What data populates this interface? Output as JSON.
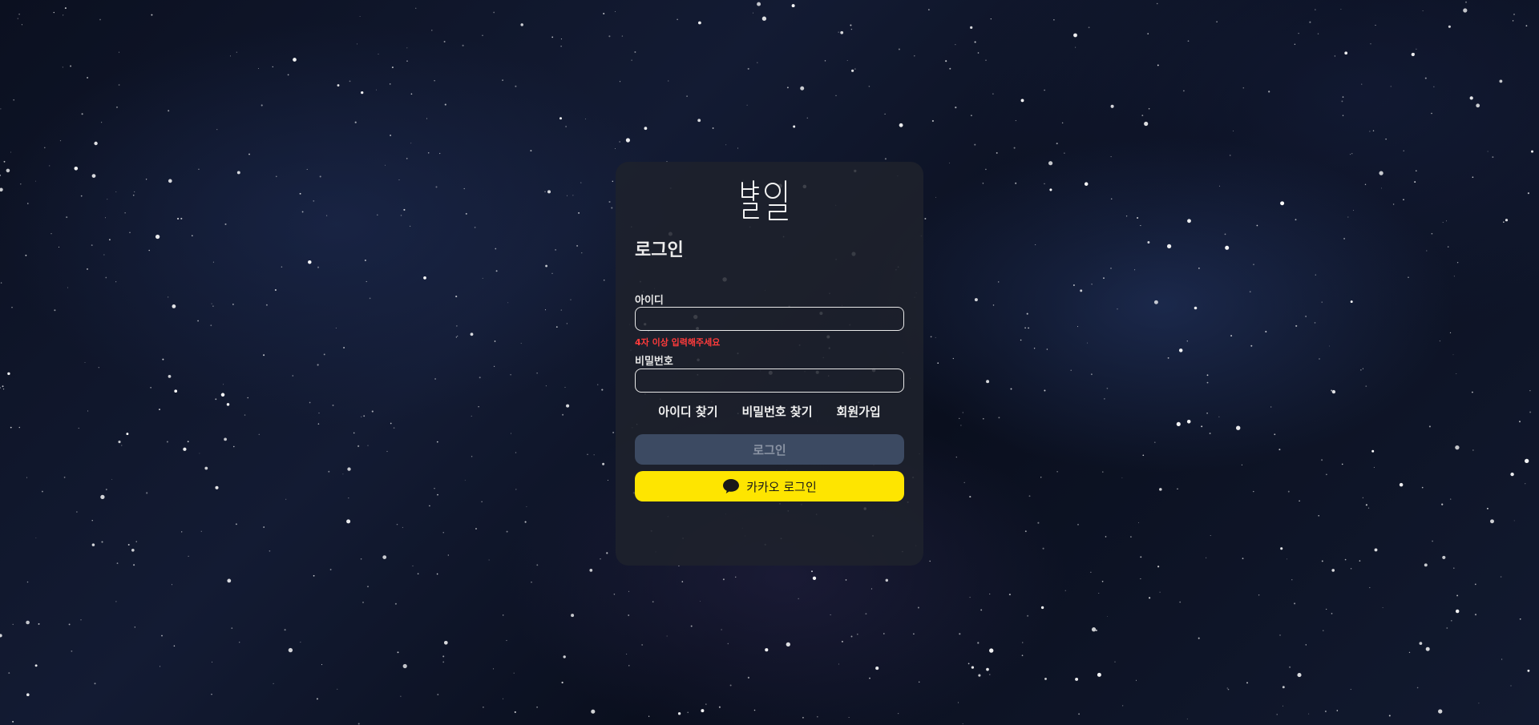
{
  "brand": {
    "logo_text": "별일"
  },
  "login_form": {
    "title": "로그인",
    "id_label": "아이디",
    "id_value": "",
    "id_error": "4자 이상 입력해주세요",
    "password_label": "비밀번호",
    "password_value": ""
  },
  "links": {
    "find_id": "아이디 찾기",
    "find_password": "비밀번호 찾기",
    "signup": "회원가입"
  },
  "buttons": {
    "login_label": "로그인",
    "kakao_label": "카카오 로그인"
  },
  "colors": {
    "card_background": "#1e222c",
    "error": "#ff3b3b",
    "login_button_disabled": "#3c4a62",
    "kakao_yellow": "#fee500"
  },
  "icons": {
    "kakao": "speech-bubble-icon"
  }
}
